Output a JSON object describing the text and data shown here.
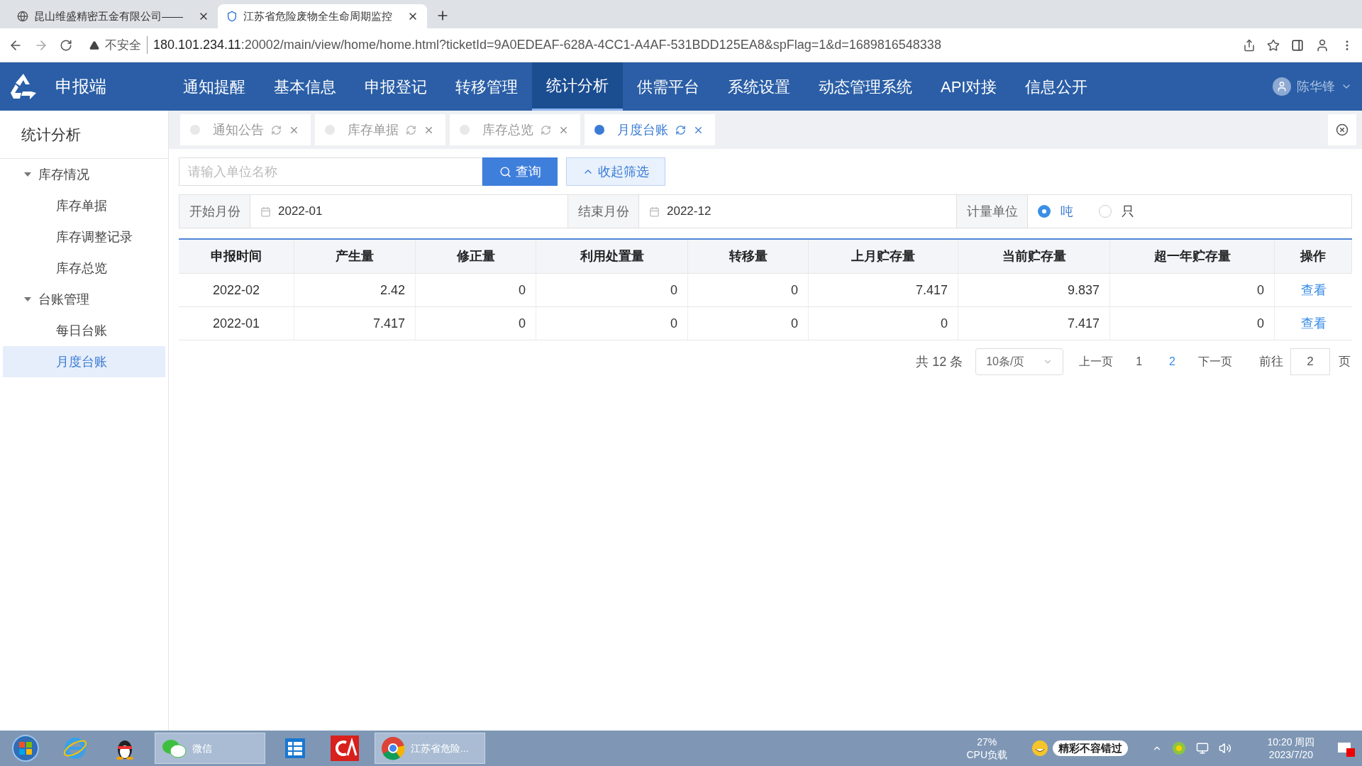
{
  "browser": {
    "tabs": [
      {
        "title": "昆山维盛精密五金有限公司——",
        "selected": false
      },
      {
        "title": "江苏省危险废物全生命周期监控",
        "selected": true
      }
    ],
    "address": {
      "security": "不安全",
      "host": "180.101.234.11",
      "path": ":20002/main/view/home/home.html?ticketId=9A0EDEAF-628A-4CC1-A4AF-531BDD125EA8&spFlag=1&d=1689816548338"
    }
  },
  "header": {
    "app_name": "申报端",
    "nav": [
      {
        "label": "通知提醒",
        "selected": false
      },
      {
        "label": "基本信息",
        "selected": false
      },
      {
        "label": "申报登记",
        "selected": false
      },
      {
        "label": "转移管理",
        "selected": false
      },
      {
        "label": "统计分析",
        "selected": true
      },
      {
        "label": "供需平台",
        "selected": false
      },
      {
        "label": "系统设置",
        "selected": false
      },
      {
        "label": "动态管理系统",
        "selected": false
      },
      {
        "label": "API对接",
        "selected": false
      },
      {
        "label": "信息公开",
        "selected": false
      }
    ],
    "user": "陈华锋"
  },
  "sidebar": {
    "title": "统计分析",
    "groups": [
      {
        "label": "库存情况",
        "expanded": true,
        "children": [
          {
            "label": "库存单据",
            "selected": false
          },
          {
            "label": "库存调整记录",
            "selected": false
          },
          {
            "label": "库存总览",
            "selected": false
          }
        ]
      },
      {
        "label": "台账管理",
        "expanded": true,
        "children": [
          {
            "label": "每日台账",
            "selected": false
          },
          {
            "label": "月度台账",
            "selected": true
          }
        ]
      }
    ]
  },
  "page_tabs": [
    {
      "label": "通知公告",
      "selected": false
    },
    {
      "label": "库存单据",
      "selected": false
    },
    {
      "label": "库存总览",
      "selected": false
    },
    {
      "label": "月度台账",
      "selected": true
    }
  ],
  "search": {
    "placeholder": "请输入单位名称",
    "button": "查询",
    "toggle": "收起筛选"
  },
  "filters": {
    "start": {
      "label": "开始月份",
      "value": "2022-01"
    },
    "end": {
      "label": "结束月份",
      "value": "2022-12"
    },
    "unit": {
      "label": "计量单位",
      "options": [
        {
          "label": "吨",
          "selected": true
        },
        {
          "label": "只",
          "selected": false
        }
      ]
    }
  },
  "table": {
    "columns": [
      "申报时间",
      "产生量",
      "修正量",
      "利用处置量",
      "转移量",
      "上月贮存量",
      "当前贮存量",
      "超一年贮存量",
      "操作"
    ],
    "rows": [
      {
        "cells": [
          "2022-02",
          "2.42",
          "0",
          "0",
          "0",
          "7.417",
          "9.837",
          "0"
        ],
        "action": "查看"
      },
      {
        "cells": [
          "2022-01",
          "7.417",
          "0",
          "0",
          "0",
          "0",
          "7.417",
          "0"
        ],
        "action": "查看"
      }
    ]
  },
  "pagination": {
    "total": "共 12 条",
    "page_size": "10条/页",
    "prev": "上一页",
    "pages": [
      {
        "label": "1",
        "selected": false
      },
      {
        "label": "2",
        "selected": true
      }
    ],
    "next": "下一页",
    "goto_label": "前往",
    "goto_value": "2",
    "goto_suffix": "页"
  },
  "taskbar": {
    "apps": [
      {
        "kind": "start"
      },
      {
        "kind": "ie"
      },
      {
        "kind": "qq"
      },
      {
        "kind": "wechat",
        "label": "微信"
      },
      {
        "kind": "files"
      },
      {
        "kind": "ca"
      },
      {
        "kind": "chrome",
        "label": "江苏省危险..."
      }
    ],
    "cpu_value": "27%",
    "cpu_label": "CPU负载",
    "promo": "精彩不容错过",
    "time": "10:20 周四",
    "date": "2023/7/20"
  }
}
